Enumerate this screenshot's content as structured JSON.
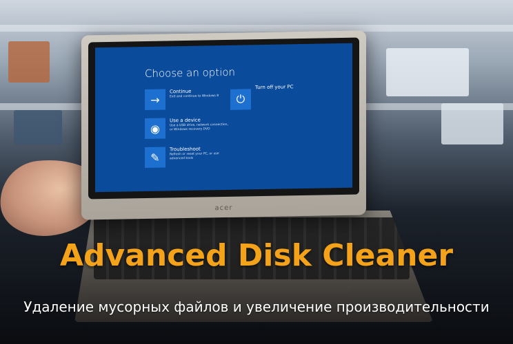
{
  "screen": {
    "title": "Choose an option",
    "options": [
      {
        "label": "Continue",
        "desc": "Exit and continue to Windows 8",
        "icon": "arrow-right-icon"
      },
      {
        "label": "Use a device",
        "desc": "Use a USB drive, network connection, or Windows recovery DVD",
        "icon": "disc-icon"
      },
      {
        "label": "Troubleshoot",
        "desc": "Refresh or reset your PC, or use advanced tools",
        "icon": "tools-icon"
      },
      {
        "label": "Turn off your PC",
        "desc": "",
        "icon": "power-icon"
      }
    ]
  },
  "laptop": {
    "brand": "acer"
  },
  "headline": "Advanced Disk Cleaner",
  "subline": "Удаление мусорных файлов и увеличение производительности",
  "colors": {
    "headline": "#f4a21a",
    "screen": "#0b4b9b",
    "tile": "#1d6fd0"
  }
}
